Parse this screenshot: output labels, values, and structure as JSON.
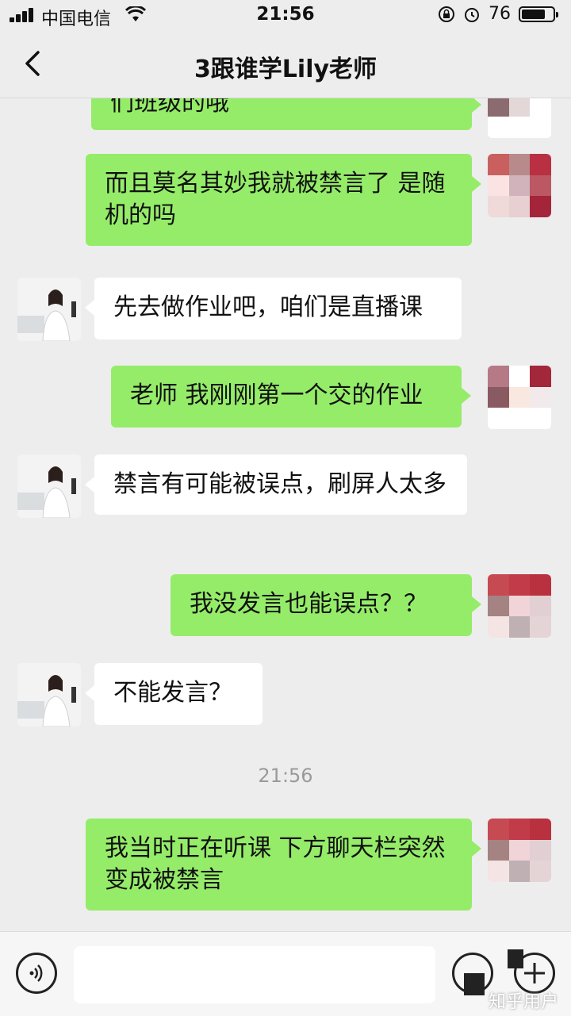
{
  "status_bar": {
    "carrier": "中国电信",
    "time": "21:56",
    "battery_text": "76",
    "battery_level": 0.76
  },
  "nav": {
    "title": "3跟谁学Lily老师"
  },
  "messages": [
    {
      "side": "out",
      "text": "们班级的哦"
    },
    {
      "side": "out",
      "text": "而且莫名其妙我就被禁言了 是随机的吗"
    },
    {
      "side": "in",
      "text": "先去做作业吧，咱们是直播课"
    },
    {
      "side": "out",
      "text": "老师 我刚刚第一个交的作业"
    },
    {
      "side": "in",
      "text": "禁言有可能被误点，刷屏人太多"
    },
    {
      "side": "out",
      "text": "我没发言也能误点？？"
    },
    {
      "side": "in",
      "text": "不能发言？"
    },
    {
      "side": "time",
      "text": "21:56"
    },
    {
      "side": "out",
      "text": "我当时正在听课 下方聊天栏突然变成被禁言"
    }
  ],
  "input_bar": {
    "voice_icon": "voice-icon",
    "emoji_icon": "emoji-icon",
    "plus_icon": "plus-icon"
  },
  "watermark": "知乎用户",
  "colors": {
    "outgoing_bubble": "#95ec69",
    "incoming_bubble": "#ffffff",
    "background": "#ededed"
  }
}
